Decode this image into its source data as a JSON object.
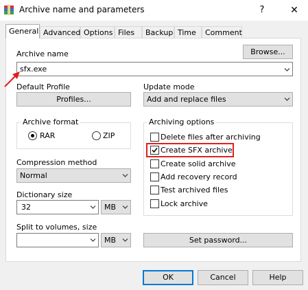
{
  "window": {
    "title": "Archive name and parameters",
    "help_glyph": "?",
    "close_glyph": "✕"
  },
  "tabs": [
    "General",
    "Advanced",
    "Options",
    "Files",
    "Backup",
    "Time",
    "Comment"
  ],
  "archive_name": {
    "label": "Archive name",
    "value": "sfx.exe",
    "browse_label": "Browse..."
  },
  "default_profile": {
    "label": "Default Profile",
    "button_label": "Profiles..."
  },
  "update_mode": {
    "label": "Update mode",
    "value": "Add and replace files"
  },
  "archive_format": {
    "label": "Archive format",
    "options": [
      "RAR",
      "ZIP"
    ],
    "selected": "RAR"
  },
  "compression_method": {
    "label": "Compression method",
    "value": "Normal"
  },
  "dictionary_size": {
    "label": "Dictionary size",
    "value": "32",
    "unit": "MB"
  },
  "split_volumes": {
    "label": "Split to volumes, size",
    "value": "",
    "unit": "MB"
  },
  "archiving_options": {
    "label": "Archiving options",
    "items": [
      {
        "label": "Delete files after archiving",
        "checked": false
      },
      {
        "label": "Create SFX archive",
        "checked": true
      },
      {
        "label": "Create solid archive",
        "checked": false
      },
      {
        "label": "Add recovery record",
        "checked": false
      },
      {
        "label": "Test archived files",
        "checked": false
      },
      {
        "label": "Lock archive",
        "checked": false
      }
    ]
  },
  "set_password_label": "Set password...",
  "footer": {
    "ok_label": "OK",
    "cancel_label": "Cancel",
    "help_label": "Help"
  },
  "colors": {
    "annotation_red": "#e02020",
    "focus_blue": "#0078d7"
  },
  "icons": {
    "app": "winrar-icon",
    "dropdown": "chevron-down-icon",
    "annotation": "red-arrow-icon"
  }
}
